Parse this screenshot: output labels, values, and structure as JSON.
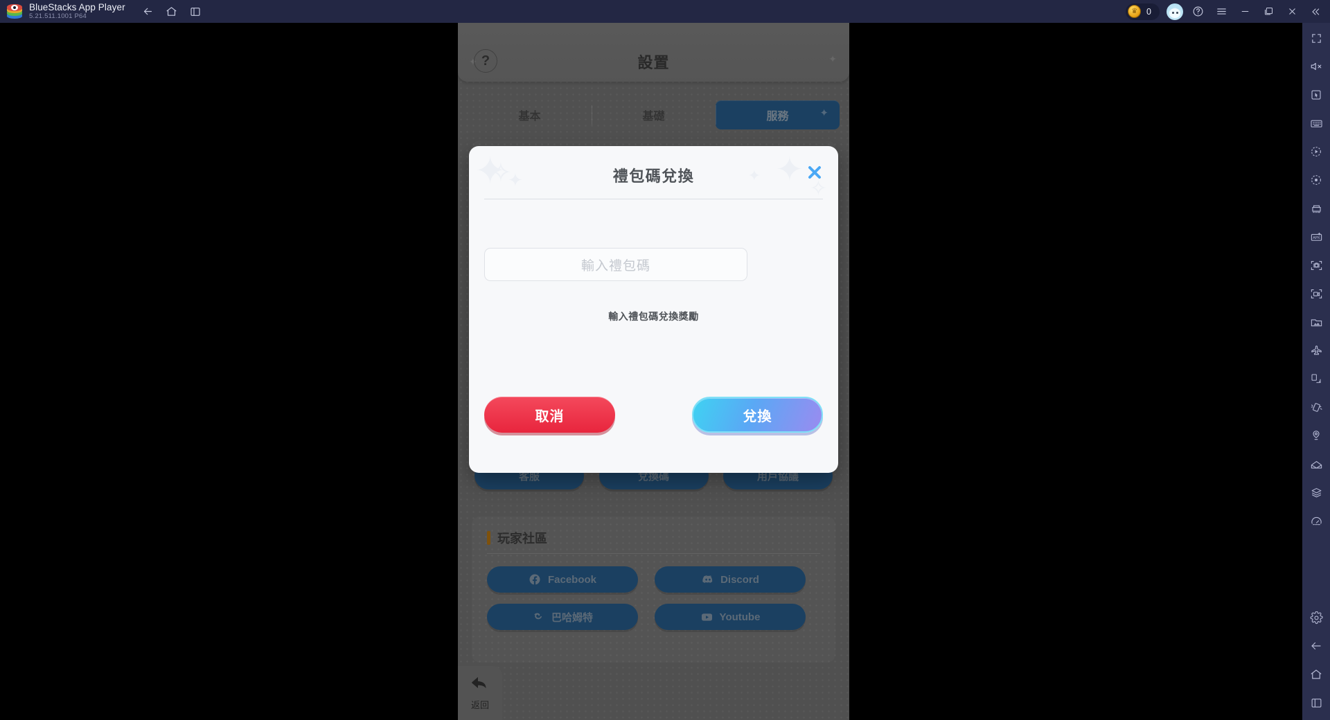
{
  "titlebar": {
    "app_name": "BlueStacks App Player",
    "version": "5.21.511.1001  P64",
    "logo_icon": "bluestacks-logo",
    "nav": [
      {
        "name": "back-arrow-icon",
        "glyph": "←"
      },
      {
        "name": "home-icon",
        "glyph": "⌂"
      },
      {
        "name": "recents-icon",
        "glyph": "❐"
      }
    ],
    "coin_count": "0",
    "coin_icon": "coin-icon",
    "avatar_icon": "bunny-avatar",
    "help_icon": "question-circle-icon",
    "menu_icon": "hamburger-menu-icon",
    "minimize_icon": "minimize-icon",
    "maximize_icon": "maximize-icon",
    "close_icon": "close-icon",
    "collapse_icon": "double-chevron-left-icon"
  },
  "game": {
    "header": {
      "title": "設置",
      "help_label": "?"
    },
    "tabs": [
      {
        "label": "基本",
        "active": false
      },
      {
        "label": "基礎",
        "active": false
      },
      {
        "label": "服務",
        "active": true
      }
    ],
    "service_buttons": [
      {
        "label": "客服"
      },
      {
        "label": "兌換碼"
      },
      {
        "label": "用戶協議"
      }
    ],
    "community": {
      "heading": "玩家社區",
      "links": [
        {
          "label": "Facebook",
          "icon": "facebook-icon"
        },
        {
          "label": "Discord",
          "icon": "discord-icon"
        },
        {
          "label": "巴哈姆特",
          "icon": "bahamut-icon"
        },
        {
          "label": "Youtube",
          "icon": "youtube-icon"
        }
      ]
    },
    "back_button": {
      "label": "返回",
      "icon": "back-arrow-icon"
    }
  },
  "modal": {
    "title": "禮包碼兌換",
    "close_icon": "close-x-icon",
    "input_placeholder": "輸入禮包碼",
    "input_value": "",
    "hint": "輸入禮包碼兌換獎勵",
    "cancel_label": "取消",
    "redeem_label": "兌換"
  },
  "sidebar": {
    "items": [
      {
        "name": "fullscreen-icon"
      },
      {
        "name": "mute-icon"
      },
      {
        "name": "cursor-icon"
      },
      {
        "name": "keyboard-controls-icon"
      },
      {
        "name": "macro-play-icon"
      },
      {
        "name": "macro-record-icon"
      },
      {
        "name": "multi-instance-icon"
      },
      {
        "name": "install-apk-icon"
      },
      {
        "name": "screenshot-icon"
      },
      {
        "name": "record-video-icon"
      },
      {
        "name": "media-manager-icon"
      },
      {
        "name": "eco-mode-icon"
      },
      {
        "name": "rotate-icon"
      },
      {
        "name": "shake-icon"
      },
      {
        "name": "location-icon"
      },
      {
        "name": "mail-icon"
      },
      {
        "name": "layers-icon"
      },
      {
        "name": "performance-icon"
      }
    ],
    "bottom_items": [
      {
        "name": "settings-gear-icon"
      },
      {
        "name": "android-back-icon"
      },
      {
        "name": "android-home-icon"
      },
      {
        "name": "android-recents-icon"
      }
    ]
  },
  "colors": {
    "titlebar_bg": "#232744",
    "sidebar_bg": "#2b2f4e",
    "accent_blue": "#2f6ea8",
    "cancel_red": "#e8253d",
    "community_accent": "#d98c16",
    "close_x_blue": "#4aa8f5"
  }
}
